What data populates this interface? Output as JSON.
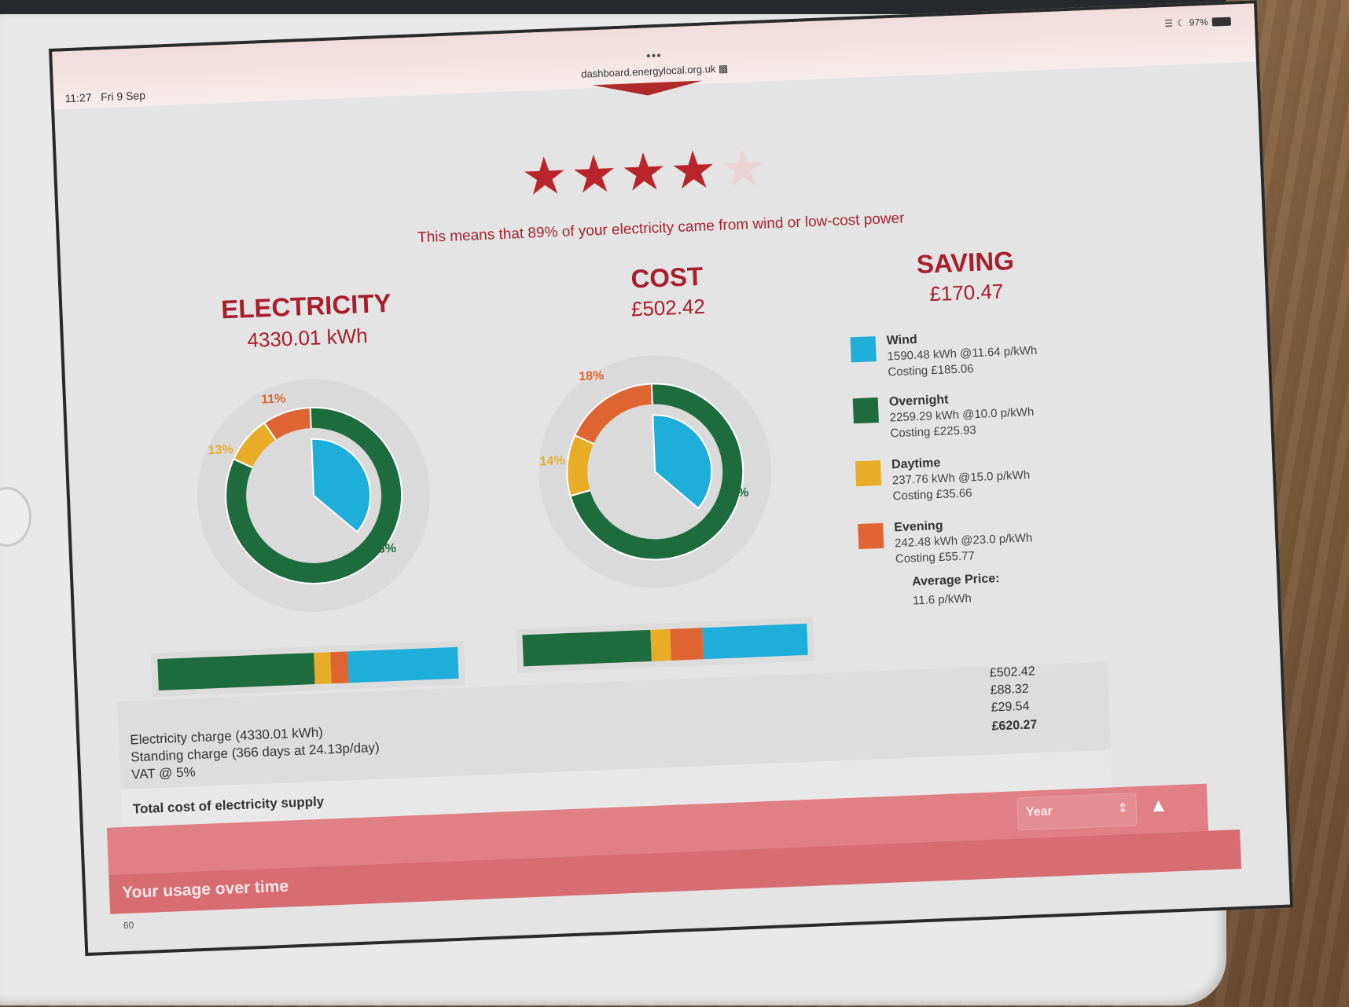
{
  "status": {
    "time": "11:27",
    "date": "Fri 9 Sep",
    "url": "dashboard.energylocal.org.uk",
    "battery": "97%",
    "dots": "•••"
  },
  "rating": {
    "filled": 4,
    "total": 5,
    "message": "This means that 89% of your electricity came from wind or low-cost power"
  },
  "electricity": {
    "title": "ELECTRICITY",
    "value": "4330.01 kWh",
    "labels": {
      "evening": "11%",
      "daytime": "13%",
      "overnight": "76%"
    }
  },
  "cost": {
    "title": "COST",
    "value": "£502.42",
    "labels": {
      "evening": "18%",
      "daytime": "14%",
      "overnight": "68%"
    }
  },
  "saving": {
    "title": "SAVING",
    "value": "£170.47"
  },
  "colors": {
    "wind": "#1eaed9",
    "overnight": "#1e6b3e",
    "daytime": "#e8ac27",
    "evening": "#de6532"
  },
  "legend": [
    {
      "key": "wind",
      "name": "Wind",
      "detail": "1590.48 kWh @11.64 p/kWh",
      "costing": "Costing £185.06"
    },
    {
      "key": "overnight",
      "name": "Overnight",
      "detail": "2259.29 kWh @10.0 p/kWh",
      "costing": "Costing £225.93"
    },
    {
      "key": "daytime",
      "name": "Daytime",
      "detail": "237.76 kWh @15.0 p/kWh",
      "costing": "Costing £35.66"
    },
    {
      "key": "evening",
      "name": "Evening",
      "detail": "242.48 kWh @23.0 p/kWh",
      "costing": "Costing £55.77"
    }
  ],
  "average": {
    "label": "Average Price:",
    "value": "11.6 p/kWh"
  },
  "bill": {
    "lines": [
      {
        "label": "Electricity charge (4330.01 kWh)",
        "amount": "£502.42"
      },
      {
        "label": "Standing charge (366 days at 24.13p/day)",
        "amount": "£88.32"
      },
      {
        "label": "VAT @ 5%",
        "amount": "£29.54"
      }
    ],
    "total_label": "Total cost of electricity supply",
    "total_amount": "£620.27"
  },
  "period_select": {
    "value": "Year"
  },
  "usage_section": {
    "title": "Your usage over time",
    "axis_first_tick": "60"
  }
}
